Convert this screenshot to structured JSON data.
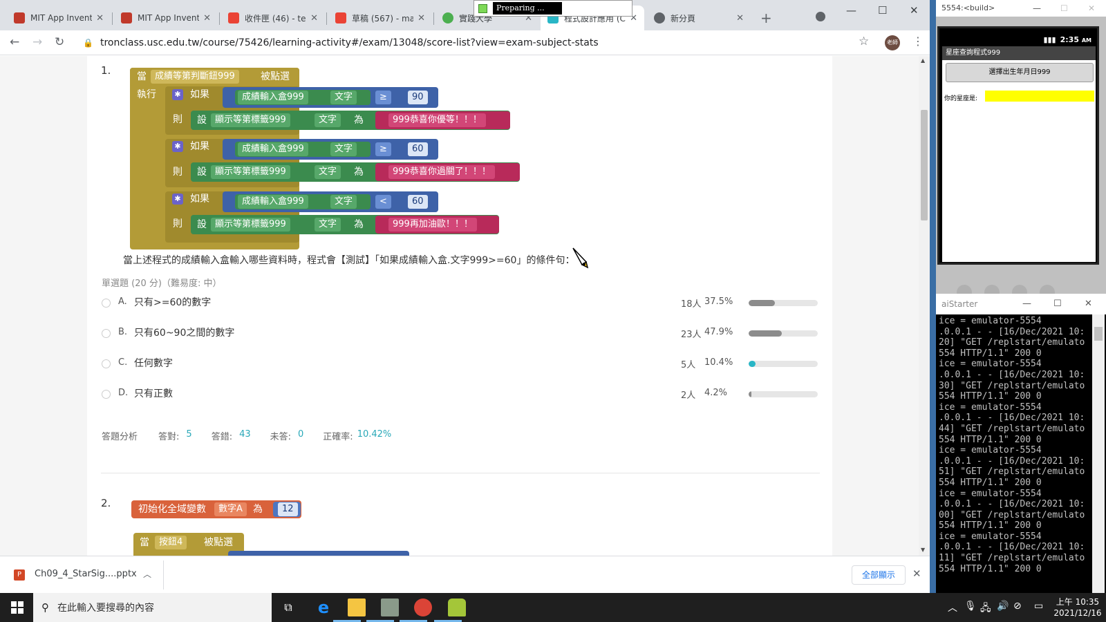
{
  "browser": {
    "tabs": [
      {
        "title": "MIT App Invent",
        "favicon_color": "#c0392b"
      },
      {
        "title": "MIT App Invent",
        "favicon_color": "#c0392b"
      },
      {
        "title": "收件匣 (46) - tec",
        "favicon_color": "#ea4335"
      },
      {
        "title": "草稿 (567) - ma",
        "favicon_color": "#ea4335"
      },
      {
        "title": "實踐大學",
        "favicon_color": "#4caf50"
      },
      {
        "title": "程式設計應用 (C",
        "favicon_color": "#29b6c6"
      },
      {
        "title": "新分頁",
        "favicon_color": "#5f6368"
      }
    ],
    "url": "tronclass.usc.edu.tw/course/75426/learning-activity#/exam/13048/score-list?view=exam-subject-stats",
    "avatar_text": "老師"
  },
  "popup": {
    "text": "Preparing ..."
  },
  "q1": {
    "number": "1.",
    "event": {
      "when": "當",
      "component": "成績等第判斷鈕999",
      "event": "被點選",
      "do": "執行"
    },
    "ifs": [
      {
        "if_label": "如果",
        "component": "成績輸入盒999",
        "prop": "文字",
        "op": "≥",
        "num": "90",
        "then": "則",
        "set": "設",
        "target": "顯示等第標籤999",
        "tprop": "文字",
        "to": "為",
        "text": "999恭喜你優等！！！"
      },
      {
        "if_label": "如果",
        "component": "成績輸入盒999",
        "prop": "文字",
        "op": "≥",
        "num": "60",
        "then": "則",
        "set": "設",
        "target": "顯示等第標籤999",
        "tprop": "文字",
        "to": "為",
        "text": "999恭喜你過關了！！！"
      },
      {
        "if_label": "如果",
        "component": "成績輸入盒999",
        "prop": "文字",
        "op": "<",
        "num": "60",
        "then": "則",
        "set": "設",
        "target": "顯示等第標籤999",
        "tprop": "文字",
        "to": "為",
        "text": "999再加油歐！！！"
      }
    ],
    "question": "當上述程式的成績輸入盒輸入哪些資料時，程式會【測試】「如果成績輸入盒.文字999>=60」的條件句：",
    "type": "單選題 (20 分)（難易度: 中）",
    "options": [
      {
        "letter": "A.",
        "text": "只有>=60的數字",
        "count": "18人",
        "pct": "37.5%",
        "fraction": 0.375
      },
      {
        "letter": "B.",
        "text": "只有60~90之間的數字",
        "count": "23人",
        "pct": "47.9%",
        "fraction": 0.479
      },
      {
        "letter": "C.",
        "text": "任何數字",
        "count": "5人",
        "pct": "10.4%",
        "fraction": 0.104
      },
      {
        "letter": "D.",
        "text": "只有正數",
        "count": "2人",
        "pct": "4.2%",
        "fraction": 0.042
      }
    ],
    "analysis": {
      "title": "答題分析",
      "correct_label": "答對:",
      "correct": "5",
      "wrong_label": "答錯:",
      "wrong": "43",
      "unanswered_label": "未答:",
      "unanswered": "0",
      "rate_label": "正確率:",
      "rate": "10.42%"
    }
  },
  "q2": {
    "number": "2.",
    "init": {
      "label": "初始化全域變數",
      "var": "數字A",
      "to": "為",
      "value": "12"
    },
    "event": {
      "when": "當",
      "component": "按鈕4",
      "event": "被點選"
    }
  },
  "download": {
    "file": "Ch09_4_StarSig....pptx",
    "show_all": "全部顯示"
  },
  "emulator": {
    "title": "5554:<build>",
    "time": "2:35",
    "ampm": "AM",
    "app_title": "星座查詢程式999",
    "button": "選擇出生年月日999",
    "label": "你的星座是:"
  },
  "aistarter": {
    "title": "aiStarter",
    "log": "ice = emulator-5554\n.0.0.1 - - [16/Dec/2021 10:\n20] \"GET /replstart/emulato\n554 HTTP/1.1\" 200 0\nice = emulator-5554\n.0.0.1 - - [16/Dec/2021 10:\n30] \"GET /replstart/emulato\n554 HTTP/1.1\" 200 0\nice = emulator-5554\n.0.0.1 - - [16/Dec/2021 10:\n44] \"GET /replstart/emulato\n554 HTTP/1.1\" 200 0\nice = emulator-5554\n.0.0.1 - - [16/Dec/2021 10:\n51] \"GET /replstart/emulato\n554 HTTP/1.1\" 200 0\nice = emulator-5554\n.0.0.1 - - [16/Dec/2021 10:\n00] \"GET /replstart/emulato\n554 HTTP/1.1\" 200 0\nice = emulator-5554\n.0.0.1 - - [16/Dec/2021 10:\n11] \"GET /replstart/emulato\n554 HTTP/1.1\" 200 0"
  },
  "taskbar": {
    "search_placeholder": "在此輸入要搜尋的內容",
    "time": "上午 10:35",
    "date": "2021/12/16"
  }
}
